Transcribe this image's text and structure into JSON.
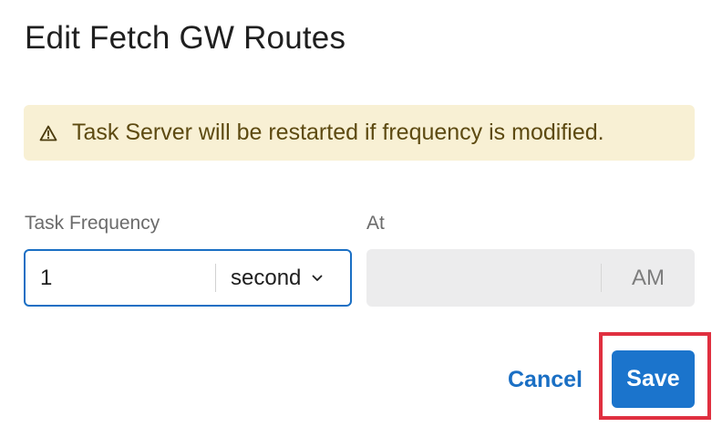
{
  "dialog": {
    "title": "Edit Fetch GW Routes"
  },
  "alert": {
    "icon": "warning-icon",
    "message": "Task Server will be restarted if frequency is modified."
  },
  "frequency": {
    "label": "Task Frequency",
    "value": "1",
    "unit": "second",
    "unit_icon": "chevron-down-icon"
  },
  "at": {
    "label": "At",
    "value": "",
    "meridiem": "AM"
  },
  "actions": {
    "cancel_label": "Cancel",
    "save_label": "Save"
  },
  "colors": {
    "accent": "#1b74cc",
    "alert_bg": "#f8f0d4",
    "highlight": "#e03040"
  }
}
